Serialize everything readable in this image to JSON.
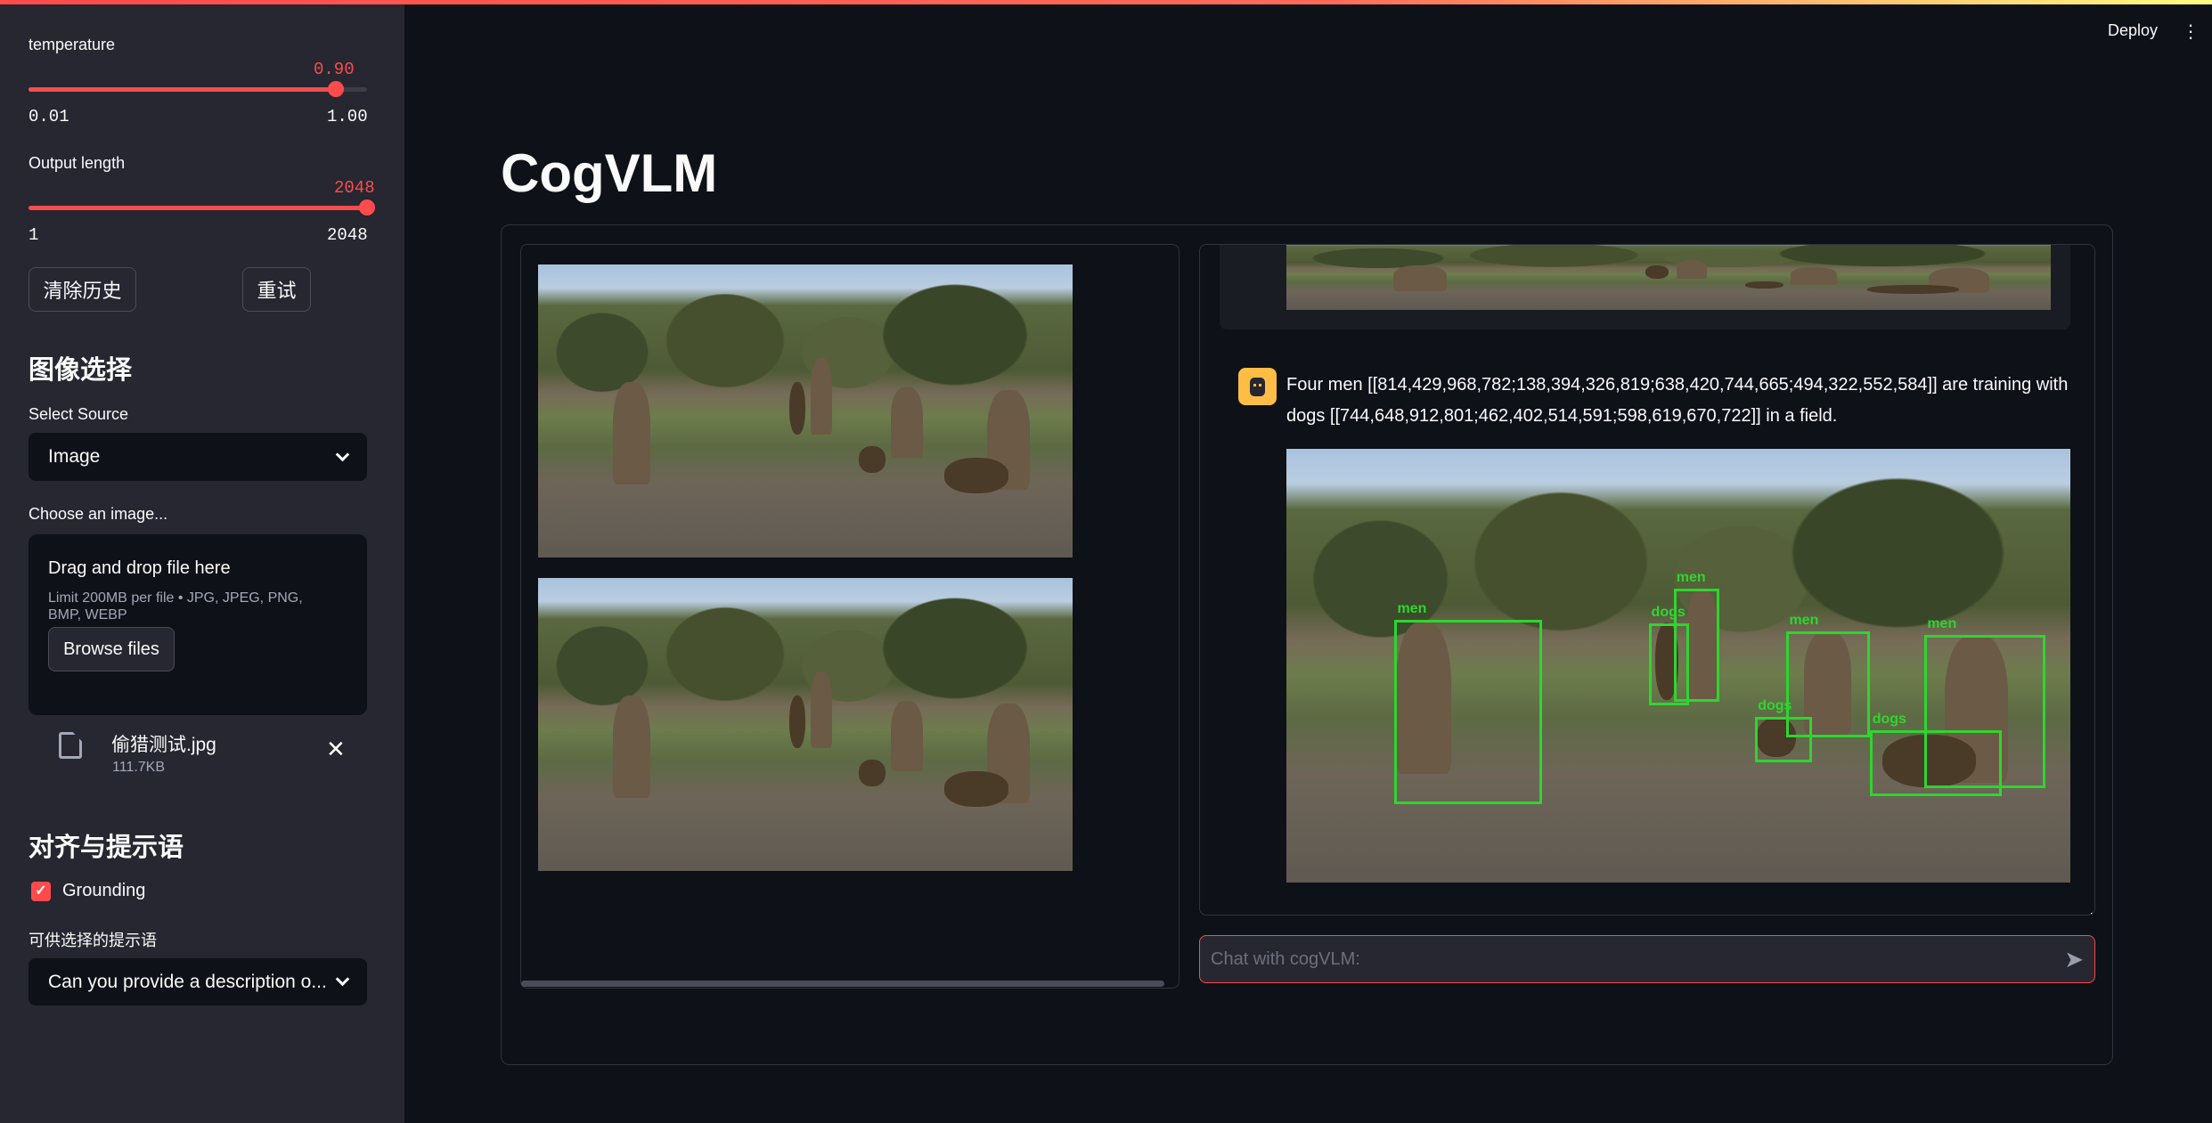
{
  "header": {
    "deploy_label": "Deploy",
    "menu_icon": "vertical-dots-icon"
  },
  "sidebar": {
    "temperature": {
      "label": "temperature",
      "value": "0.90",
      "min": "0.01",
      "max": "1.00",
      "fraction": 0.909
    },
    "output_length": {
      "label": "Output length",
      "value": "2048",
      "min": "1",
      "max": "2048",
      "fraction": 1.0
    },
    "clear_history_label": "清除历史",
    "retry_label": "重试",
    "image_section_title": "图像选择",
    "select_source": {
      "label": "Select Source",
      "value": "Image"
    },
    "uploader": {
      "label": "Choose an image...",
      "drop_text": "Drag and drop file here",
      "limit_text": "Limit 200MB per file • JPG, JPEG, PNG, BMP, WEBP",
      "browse_label": "Browse files"
    },
    "file": {
      "name": "偷猎测试.jpg",
      "size": "111.7KB"
    },
    "prompt_section_title": "对齐与提示语",
    "grounding": {
      "label": "Grounding",
      "checked": true
    },
    "prompt_select": {
      "label": "可供选择的提示语",
      "value": "Can you provide a description o..."
    }
  },
  "main": {
    "title": "CogVLM",
    "chat": {
      "assistant_message": "Four men [[814,429,968,782;138,394,326,819;638,420,744,665;494,322,552,584]] are training with dogs [[744,648,912,801;462,402,514,591;598,619,670,722]] in a field.",
      "input_placeholder": "Chat with cogVLM:"
    }
  },
  "colors": {
    "accent": "#ff4b4b",
    "box": "#2ed62e",
    "avatar": "#ffbd45"
  }
}
